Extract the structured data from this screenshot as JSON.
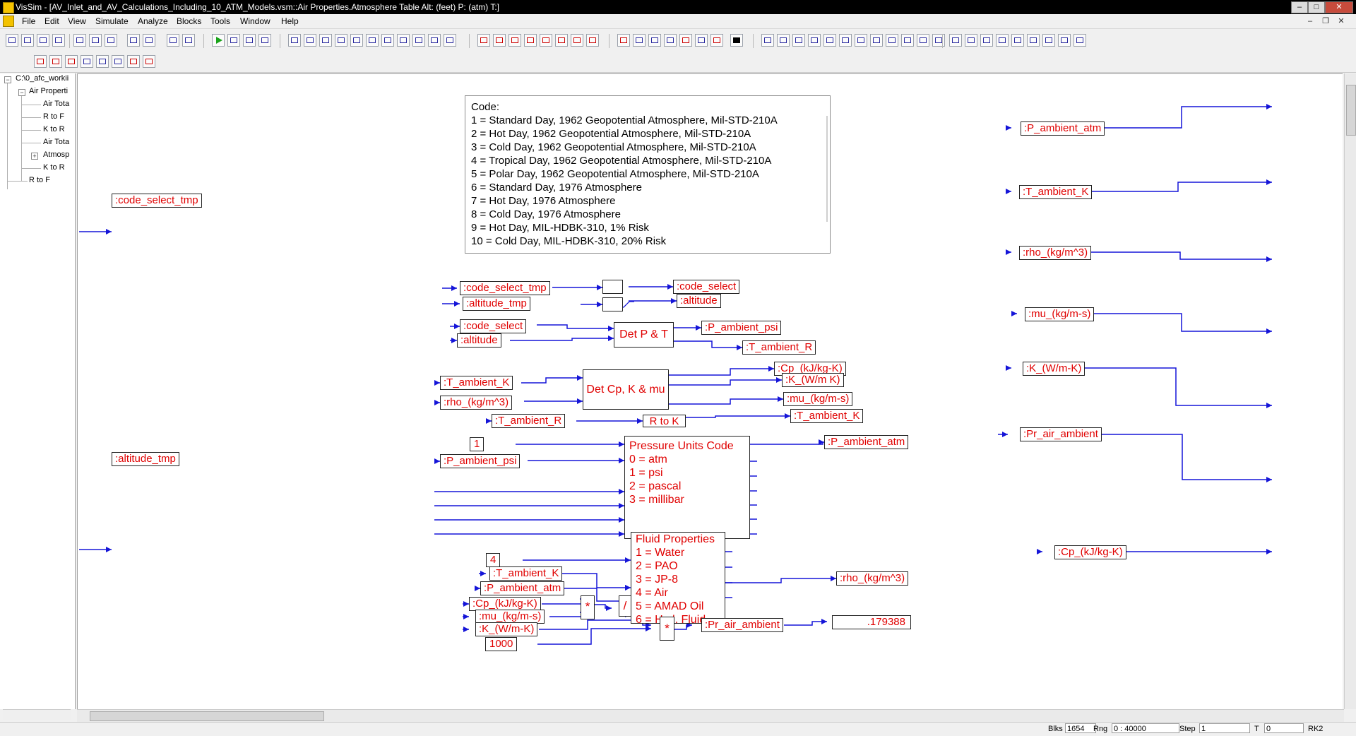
{
  "window": {
    "title": "VisSim - [AV_Inlet_and_AV_Calculations_Including_10_ATM_Models.vsm::Air Properties.Atmosphere Table Alt: (feet) P: (atm) T:]",
    "min": "–",
    "max": "□",
    "close": "✕"
  },
  "menu": [
    "File",
    "Edit",
    "View",
    "Simulate",
    "Analyze",
    "Blocks",
    "Tools",
    "Window",
    "Help"
  ],
  "mdi_controls": [
    "–",
    "❐",
    "✕"
  ],
  "tree": {
    "root": "C:\\0_afc_workii",
    "items": [
      "Air Properti",
      "Air Tota",
      "R to F",
      "K to R",
      "Air Tota",
      "Atmosp",
      "K to R",
      "R to F"
    ]
  },
  "code_note": {
    "lines": [
      "Code:",
      "1 = Standard Day, 1962 Geopotential Atmosphere, Mil-STD-210A",
      "2 = Hot Day, 1962 Geopotential Atmosphere, Mil-STD-210A",
      "3 = Cold Day, 1962 Geopotential Atmosphere, Mil-STD-210A",
      "4 = Tropical Day, 1962 Geopotential Atmosphere, Mil-STD-210A",
      "5 = Polar Day, 1962 Geopotential Atmosphere, Mil-STD-210A",
      "6 = Standard Day, 1976 Atmosphere",
      "7 = Hot Day, 1976 Atmosphere",
      "8 = Cold Day, 1976 Atmosphere",
      "9 = Hot Day, MIL-HDBK-310, 1% Risk",
      "10 = Cold Day, MIL-HDBK-310, 20% Risk"
    ]
  },
  "vars": {
    "code_select_tmp_in": ":code_select_tmp",
    "altitude_tmp_in": ":altitude_tmp",
    "code_select_tmp_2": ":code_select_tmp",
    "altitude_tmp_2": ":altitude_tmp",
    "code_select_out": ":code_select",
    "altitude_out": ":altitude",
    "code_select_2": ":code_select",
    "altitude_2": ":altitude",
    "p_ambient_psi_out": ":P_ambient_psi",
    "t_ambient_r_out": ":T_ambient_R",
    "t_ambient_k_in": ":T_ambient_K",
    "rho_in": ":rho_(kg/m^3)",
    "cp_out": ":Cp_(kJ/kg-K)",
    "k_out": ":K_(W/m K)",
    "mu_out": ":mu_(kg/m-s)",
    "t_ambient_r_in": ":T_ambient_R",
    "t_ambient_k_out": ":T_ambient_K",
    "p_ambient_psi_in": ":P_ambient_psi",
    "p_ambient_atm_out": ":P_ambient_atm",
    "t_ambient_k_in2": ":T_ambient_K",
    "p_ambient_atm_in": ":P_ambient_atm",
    "rho_out": ":rho_(kg/m^3)",
    "cp_in": ":Cp_(kJ/kg-K)",
    "mu_in": ":mu_(kg/m-s)",
    "k_in": ":K_(W/m-K)",
    "pr_out": ":Pr_air_ambient",
    "r_p_ambient_atm": ":P_ambient_atm",
    "r_t_ambient_k": ":T_ambient_K",
    "r_rho": ":rho_(kg/m^3)",
    "r_mu": ":mu_(kg/m-s)",
    "r_k": ":K_(W/m-K)",
    "r_pr": ":Pr_air_ambient",
    "r_cp": ":Cp_(kJ/kg-K)"
  },
  "blocks": {
    "det_pt": "Det P & T",
    "det_cp": "Det Cp, K & mu",
    "r_to_k": "R to K",
    "pressure_units": [
      "Pressure Units Code",
      "0 = atm",
      "1 = psi",
      "2 = pascal",
      "3 = millibar"
    ],
    "fluid_props": [
      "Fluid Properties",
      "1 = Water",
      "2 = PAO",
      "3 = JP-8",
      "4 = Air",
      "5 = AMAD Oil",
      "6 = Hyd. Fluid"
    ]
  },
  "consts": {
    "c1": "1",
    "c4": "4",
    "c1000": "1000"
  },
  "ops": {
    "mul1": "*",
    "div": "/",
    "mul2": "*"
  },
  "display": {
    "pr_value": ".179388"
  },
  "status": {
    "blks_label": "Blks",
    "blks_value": "1654",
    "rng_label": "Rng",
    "rng_value": "0 : 40000",
    "step_label": "Step",
    "step_value": "1",
    "t_label": "T",
    "t_value": "0",
    "solver": "RK2"
  }
}
